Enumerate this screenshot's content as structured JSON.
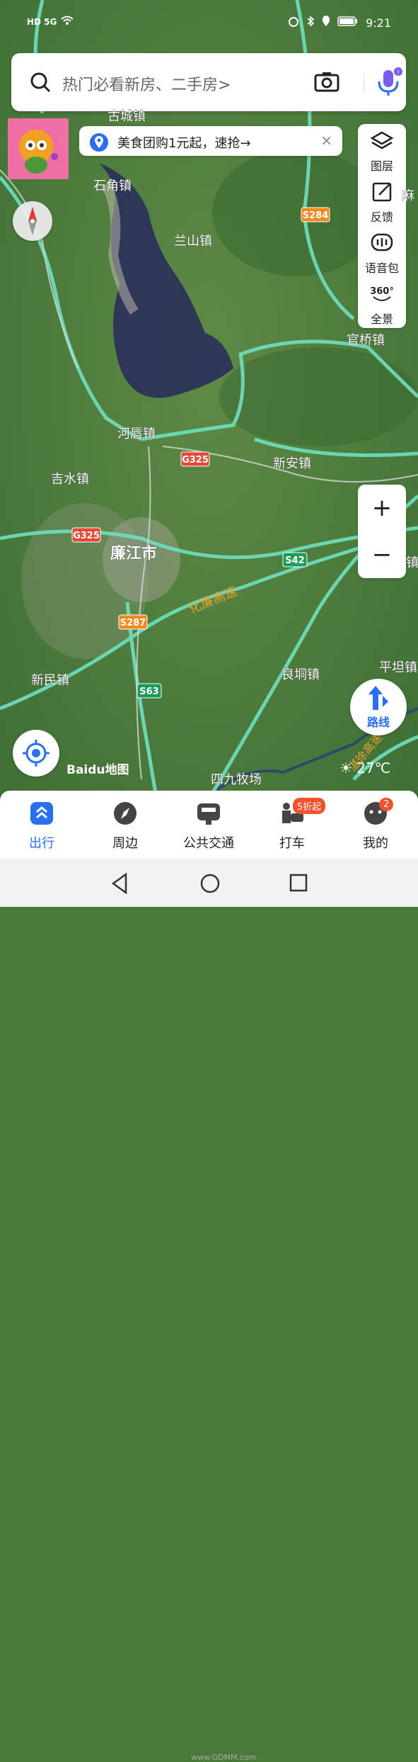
{
  "status_bar": {
    "left": "HD 5G",
    "time": "9:21"
  },
  "search": {
    "placeholder": "热门必看新房、二手房>"
  },
  "promo": {
    "text": "美食团购1元起，速抢→",
    "close": "×"
  },
  "tools": [
    {
      "label": "图层",
      "icon": "layers-icon"
    },
    {
      "label": "反馈",
      "icon": "feedback-icon"
    },
    {
      "label": "语音包",
      "icon": "voice-pack-icon"
    },
    {
      "label": "全景",
      "icon": "panorama-360-icon",
      "badge": "360°"
    }
  ],
  "zoom": {
    "in": "+",
    "out": "−"
  },
  "route": {
    "label": "路线"
  },
  "logo": {
    "text": "Baidu地图"
  },
  "weather": {
    "temp": "27℃"
  },
  "map_labels": {
    "places": [
      "古城镇",
      "石角镇",
      "兰山镇",
      "官桥镇",
      "河唇镇",
      "新安镇",
      "吉水镇",
      "廉江市",
      "新民镇",
      "良垌镇",
      "平坦镇",
      "四九牧场",
      "麻",
      "镇"
    ],
    "roads": [
      "S284",
      "G325",
      "G325",
      "S42",
      "S287",
      "S63"
    ],
    "highway": "化廉高速",
    "highway2": "湛徐高速"
  },
  "bottom_nav": [
    {
      "label": "出行",
      "icon": "travel-icon",
      "active": true
    },
    {
      "label": "周边",
      "icon": "nearby-compass-icon",
      "active": false
    },
    {
      "label": "公共交通",
      "icon": "bus-icon",
      "active": false
    },
    {
      "label": "打车",
      "icon": "taxi-icon",
      "active": false,
      "badge": "5折起"
    },
    {
      "label": "我的",
      "icon": "profile-icon",
      "active": false,
      "badge": "2"
    }
  ],
  "colors": {
    "accent": "#2a6ff0",
    "badge": "#f0522e",
    "highway": "#6fe0c0"
  },
  "watermark": "www.GDMM.com"
}
